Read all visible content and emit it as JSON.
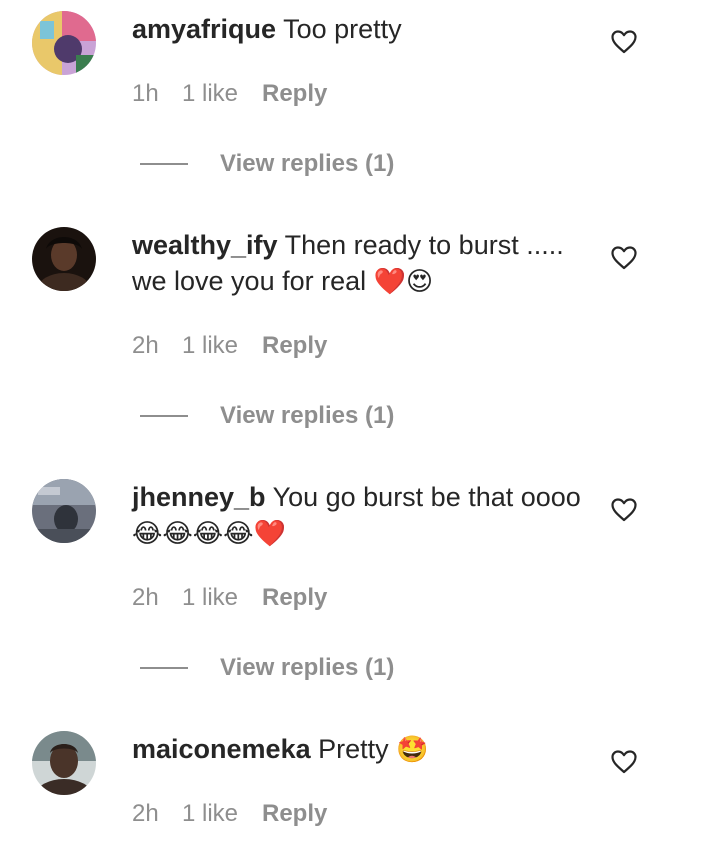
{
  "comments": [
    {
      "username": "amyafrique",
      "text": "Too pretty",
      "emoji": "",
      "time": "1h",
      "likes": "1 like",
      "reply": "Reply",
      "view_replies": "View replies (1)",
      "avatar_colors": [
        "#c9a3d6",
        "#e06a8f",
        "#4f3a6b",
        "#f1d27a"
      ]
    },
    {
      "username": "wealthy_ify",
      "text": "Then ready to burst ..... we love you for real",
      "emoji": "❤️😍",
      "time": "2h",
      "likes": "1 like",
      "reply": "Reply",
      "view_replies": "View replies (1)",
      "avatar_colors": [
        "#1a120e",
        "#5a3a2a",
        "#2b1d17",
        "#3d2a20"
      ]
    },
    {
      "username": "jhenney_b",
      "text": "You go burst be that oooo",
      "emoji": "😂😂😂😂❤️",
      "time": "2h",
      "likes": "1 like",
      "reply": "Reply",
      "view_replies": "View replies (1)",
      "avatar_colors": [
        "#6a6f7c",
        "#9aa3b0",
        "#2f333b",
        "#c4c9d2"
      ]
    },
    {
      "username": "maiconemeka",
      "text": "Pretty",
      "emoji": "🤩",
      "time": "2h",
      "likes": "1 like",
      "reply": "Reply",
      "avatar_colors": [
        "#7a8a8c",
        "#4a3429",
        "#cfd6d6",
        "#2a1f1a"
      ]
    }
  ],
  "icons": {
    "like": "heart-outline-icon"
  },
  "colors": {
    "text": "#262626",
    "muted": "#8e8e8e",
    "background": "#ffffff"
  }
}
